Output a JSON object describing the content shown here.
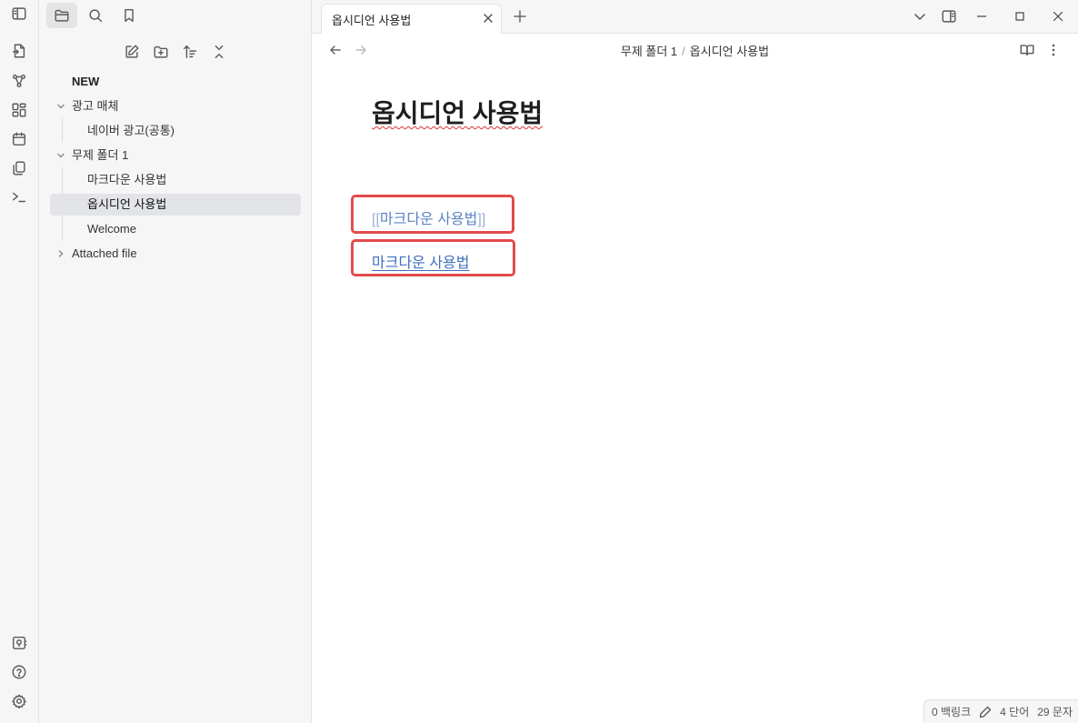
{
  "ribbon": {
    "top_icons": [
      "quick-switcher-icon",
      "graph-view-icon",
      "canvas-icon",
      "daily-note-icon",
      "templates-icon",
      "command-palette-icon"
    ],
    "bottom_icons": [
      "vault-switcher-icon",
      "help-icon",
      "settings-icon"
    ]
  },
  "sidebar": {
    "tabs": [
      "files-tab",
      "search-tab",
      "bookmarks-tab"
    ],
    "tree": {
      "root_item": "NEW",
      "folder1": {
        "label": "광고 매체",
        "children": [
          "네이버 광고(공통)"
        ]
      },
      "folder2": {
        "label": "무제 폴더 1",
        "children": [
          "마크다운 사용법",
          "옵시디언 사용법",
          "Welcome"
        ]
      },
      "folder3": {
        "label": "Attached file"
      }
    },
    "selected": "옵시디언 사용법"
  },
  "tab": {
    "title": "옵시디언 사용법"
  },
  "breadcrumb": {
    "folder": "무제 폴더 1",
    "separator": "/",
    "file": "옵시디언 사용법"
  },
  "editor": {
    "title": "옵시디언 사용법",
    "raw_link": {
      "open": "[[",
      "text": "마크다운 사용법",
      "close": "]]"
    },
    "rendered_link": "마크다운 사용법",
    "highlight_color": "#e34b4b",
    "link_color": "#3f6fbf"
  },
  "status": {
    "backlinks": "0 백링크",
    "words": "4 단어",
    "chars": "29 문자"
  }
}
